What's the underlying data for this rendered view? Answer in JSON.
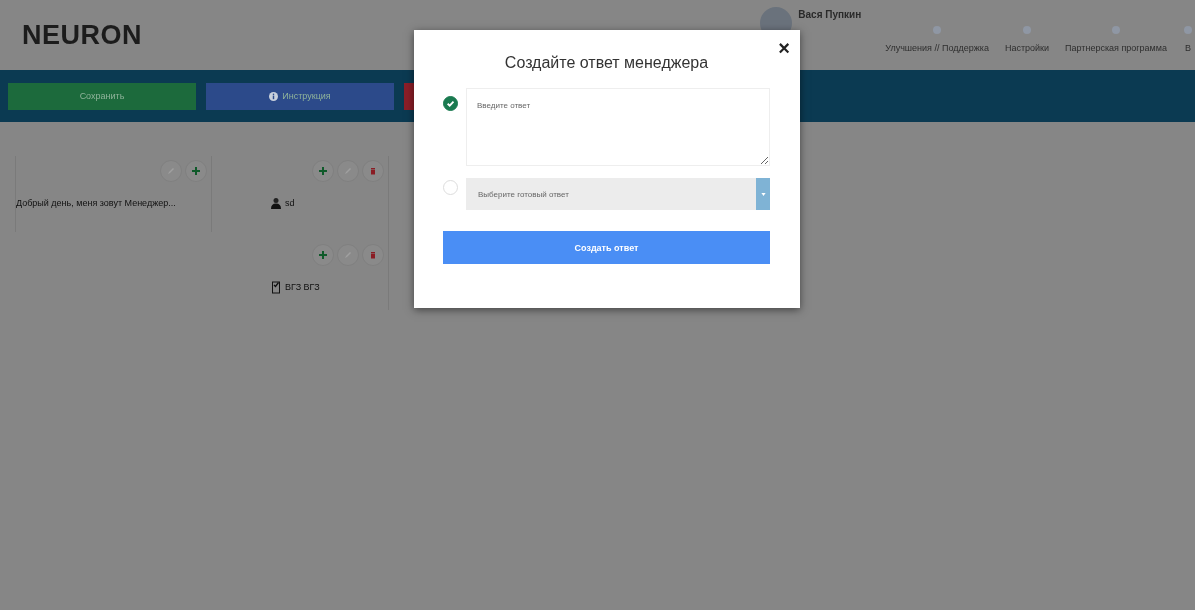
{
  "header": {
    "logo": "NEURON",
    "profile_name": "Вася Пупкин",
    "nav": [
      {
        "label": "Улучшения // Поддержка"
      },
      {
        "label": "Настройки"
      },
      {
        "label": "Партнерская программа"
      },
      {
        "label": "В"
      }
    ]
  },
  "toolbar": [
    {
      "kind": "plain",
      "label": "Сохранить",
      "color": "#1c6a3c"
    },
    {
      "kind": "info",
      "label": "Инструкция",
      "color": "#2c4a8a"
    },
    {
      "kind": "plain",
      "color": "#8c1e28"
    }
  ],
  "tree": [
    {
      "text": "Добрый день, меня зовут Менеджер...",
      "buttons": [
        {
          "kind": "edit"
        },
        {
          "kind": "add"
        }
      ]
    },
    {
      "children": [
        {
          "kind": "manager",
          "text": "sd",
          "buttons": [
            {
              "kind": "add"
            },
            {
              "kind": "edit"
            },
            {
              "kind": "delete"
            }
          ]
        },
        {
          "kind": "question",
          "text": "ВГЗ ВГЗ",
          "buttons": [
            {
              "kind": "add"
            },
            {
              "kind": "edit"
            },
            {
              "kind": "delete"
            }
          ]
        }
      ]
    }
  ],
  "modal": {
    "title": "Создайте ответ менеджера",
    "close": "×",
    "options": [
      {
        "kind": "text",
        "selected": true,
        "placeholder": "Введите ответ"
      },
      {
        "kind": "select",
        "selected": false,
        "placeholder": "Выберите готовый ответ"
      }
    ],
    "submit": "Создать ответ"
  }
}
